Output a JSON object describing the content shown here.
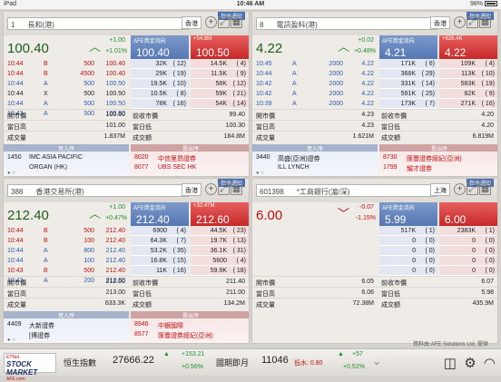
{
  "status": {
    "device": "iPad",
    "time": "10:46 AM",
    "battery": "98%"
  },
  "panels": [
    {
      "code": "1",
      "name": "長和(港)",
      "market": "香港",
      "tag": "指令通知",
      "last": "100.40",
      "last_color": "green",
      "change": "+1.00",
      "change_pct": "+1.01%",
      "direction": "up",
      "bid_label": "AFE資金流向",
      "ask_label": "+54.8M",
      "bid": "100.40",
      "ask": "100.50",
      "trades": [
        {
          "time": "10:44",
          "side": "B",
          "qty": "500",
          "price": "100.40",
          "color": "red"
        },
        {
          "time": "10:44",
          "side": "B",
          "qty": "4500",
          "price": "100.40",
          "color": "red"
        },
        {
          "time": "10:44",
          "side": "A",
          "qty": "500",
          "price": "100.50",
          "color": "blue"
        },
        {
          "time": "10:44",
          "side": "X",
          "qty": "500",
          "price": "100.50",
          "color": "blk"
        },
        {
          "time": "10:44",
          "side": "A",
          "qty": "500",
          "price": "100.50",
          "color": "blue"
        },
        {
          "time": "10:43",
          "side": "A",
          "qty": "500",
          "price": "100.50",
          "color": "blue"
        }
      ],
      "depth": [
        {
          "bid": "32K",
          "bidn": "( 12)",
          "ask": "14.5K",
          "askn": "(  4)"
        },
        {
          "bid": "29K",
          "bidn": "( 19)",
          "ask": "11.5K",
          "askn": "(  9)"
        },
        {
          "bid": "19.5K",
          "bidn": "( 10)",
          "ask": "58K",
          "askn": "( 12)"
        },
        {
          "bid": "10.5K",
          "bidn": "(  8)",
          "ask": "59K",
          "askn": "( 21)"
        },
        {
          "bid": "78K",
          "bidn": "( 16)",
          "ask": "54K",
          "askn": "( 14)"
        }
      ],
      "stats": [
        {
          "k1": "開市價",
          "v1": "100.60",
          "k2": "前收市價",
          "v2": "99.40"
        },
        {
          "k1": "當日高",
          "v1": "101.00",
          "k2": "當日低",
          "v2": "100.30"
        },
        {
          "k1": "成交量",
          "v1": "1.837M",
          "k2": "成交額",
          "v2": "184.8M"
        }
      ],
      "broker_buy_label": "買入序",
      "broker_sell_label": "賣出序",
      "broker_buy": [
        {
          "id": "1450",
          "name": "IMC ASIA PACIFIC"
        },
        {
          "id": "",
          "name": "ORGAN (HK)"
        }
      ],
      "broker_sell": [
        {
          "id": "8020",
          "name": "中信里昂證券"
        },
        {
          "id": "8077",
          "name": "UBS SEC HK"
        }
      ]
    },
    {
      "code": "8",
      "name": "電訊盈科(港)",
      "market": "香港",
      "tag": "指令通知",
      "last": "4.22",
      "last_color": "green",
      "change": "+0.02",
      "change_pct": "+0.48%",
      "direction": "up",
      "bid_label": "AFE資金流向",
      "ask_label": "+926.4K",
      "bid": "4.21",
      "ask": "4.22",
      "trades": [
        {
          "time": "10:45",
          "side": "A",
          "qty": "2000",
          "price": "4.22",
          "color": "blue"
        },
        {
          "time": "10:44",
          "side": "A",
          "qty": "2000",
          "price": "4.22",
          "color": "blue"
        },
        {
          "time": "10:42",
          "side": "A",
          "qty": "2000",
          "price": "4.22",
          "color": "blue"
        },
        {
          "time": "10:42",
          "side": "A",
          "qty": "2000",
          "price": "4.22",
          "color": "blue"
        },
        {
          "time": "10:39",
          "side": "A",
          "qty": "2000",
          "price": "4.22",
          "color": "blue"
        }
      ],
      "depth": [
        {
          "bid": "171K",
          "bidn": "(  6)",
          "ask": "109K",
          "askn": "(  4)"
        },
        {
          "bid": "368K",
          "bidn": "( 29)",
          "ask": "113K",
          "askn": "( 10)"
        },
        {
          "bid": "331K",
          "bidn": "( 14)",
          "ask": "583K",
          "askn": "( 19)"
        },
        {
          "bid": "591K",
          "bidn": "( 25)",
          "ask": "82K",
          "askn": "(  9)"
        },
        {
          "bid": "173K",
          "bidn": "(  7)",
          "ask": "271K",
          "askn": "( 16)"
        }
      ],
      "stats": [
        {
          "k1": "開市價",
          "v1": "4.23",
          "k2": "前收市價",
          "v2": "4.20"
        },
        {
          "k1": "當日高",
          "v1": "4.23",
          "k2": "當日低",
          "v2": "4.20"
        },
        {
          "k1": "成交量",
          "v1": "1.621M",
          "k2": "成交額",
          "v2": "6.819M"
        }
      ],
      "broker_buy_label": "買入序",
      "broker_sell_label": "賣出序",
      "broker_buy": [
        {
          "id": "3440",
          "name": "高盛(亞洲)證券"
        },
        {
          "id": "",
          "name": "ILL LYNCH"
        }
      ],
      "broker_sell": [
        {
          "id": "8730",
          "name": "匯豐證券經紀(亞洲)"
        },
        {
          "id": "1799",
          "name": "耀才證券"
        }
      ]
    },
    {
      "code": "388",
      "name": "香港交易所(港)",
      "market": "香港",
      "tag": "指令通知",
      "last": "212.40",
      "last_color": "green",
      "change": "+1.00",
      "change_pct": "+0.47%",
      "direction": "up",
      "bid_label": "AFE資金流向",
      "ask_label": "+32.47M",
      "bid": "212.40",
      "ask": "212.60",
      "trades": [
        {
          "time": "10:44",
          "side": "B",
          "qty": "500",
          "price": "212.40",
          "color": "red"
        },
        {
          "time": "10:44",
          "side": "B",
          "qty": "100",
          "price": "212.40",
          "color": "red"
        },
        {
          "time": "10:44",
          "side": "A",
          "qty": "800",
          "price": "212.40",
          "color": "blue"
        },
        {
          "time": "10:44",
          "side": "A",
          "qty": "100",
          "price": "212.40",
          "color": "blue"
        },
        {
          "time": "10:43",
          "side": "B",
          "qty": "500",
          "price": "212.40",
          "color": "red"
        },
        {
          "time": "10:43",
          "side": "A",
          "qty": "200",
          "price": "212.60",
          "color": "blue"
        }
      ],
      "depth": [
        {
          "bid": "6900",
          "bidn": "(  4)",
          "ask": "44.5K",
          "askn": "( 23)"
        },
        {
          "bid": "64.3K",
          "bidn": "(  7)",
          "ask": "19.7K",
          "askn": "( 13)"
        },
        {
          "bid": "53.2K",
          "bidn": "( 35)",
          "ask": "36.1K",
          "askn": "( 31)"
        },
        {
          "bid": "16.8K",
          "bidn": "( 15)",
          "ask": "5600",
          "askn": "(  4)"
        },
        {
          "bid": "11K",
          "bidn": "( 16)",
          "ask": "59.9K",
          "askn": "( 18)"
        }
      ],
      "stats": [
        {
          "k1": "開市價",
          "v1": "212.00",
          "k2": "前收市價",
          "v2": "211.40"
        },
        {
          "k1": "當日高",
          "v1": "213.00",
          "k2": "當日低",
          "v2": "211.00"
        },
        {
          "k1": "成交量",
          "v1": "633.3K",
          "k2": "成交額",
          "v2": "134.2M"
        }
      ],
      "broker_buy_label": "買入序",
      "broker_sell_label": "賣出序",
      "broker_buy": [
        {
          "id": "4409",
          "name": "大新證券"
        },
        {
          "id": "",
          "name": "[博證券"
        }
      ],
      "broker_sell": [
        {
          "id": "8946",
          "name": "中銀國際"
        },
        {
          "id": "8577",
          "name": "匯豐證券經紀(亞洲)"
        }
      ]
    },
    {
      "code": "601398",
      "name": "*工商銀行(滬/深)",
      "market": "上海",
      "tag": "指令通知",
      "last": "6.00",
      "last_color": "red",
      "change": "-0.07",
      "change_pct": "-1.15%",
      "direction": "down",
      "bid_label": "AFE資金流向",
      "ask_label": "",
      "bid": "5.99",
      "ask": "6.00",
      "trades": [],
      "depth": [
        {
          "bid": "517K",
          "bidn": "(  1)",
          "ask": "2383K",
          "askn": "(  1)"
        },
        {
          "bid": "0",
          "bidn": "(  0)",
          "ask": "0",
          "askn": "(  0)"
        },
        {
          "bid": "0",
          "bidn": "(  0)",
          "ask": "0",
          "askn": "(  0)"
        },
        {
          "bid": "0",
          "bidn": "(  0)",
          "ask": "0",
          "askn": "(  0)"
        },
        {
          "bid": "0",
          "bidn": "(  0)",
          "ask": "0",
          "askn": "(  0)"
        }
      ],
      "stats": [
        {
          "k1": "開市價",
          "v1": "6.05",
          "k2": "前收市價",
          "v2": "6.07"
        },
        {
          "k1": "當日高",
          "v1": "6.06",
          "k2": "當日低",
          "v2": "5.98"
        },
        {
          "k1": "成交量",
          "v1": "72.38M",
          "k2": "成交額",
          "v2": "435.9M"
        }
      ],
      "broker_buy_label": "",
      "broker_sell_label": "",
      "broker_buy": [],
      "broker_sell": []
    }
  ],
  "footnote": "資料由 AFE Solutions Ltd. 提供",
  "bottom": {
    "logo_top": "ETNet",
    "logo_main": "STOCK MARKET",
    "logo_sub": "AFE.com",
    "index_name": "恒生指數",
    "index_value": "27666.22",
    "index_chg": "+153.21",
    "index_pct": "+0.56%",
    "future_name": "國期即月",
    "future_value": "11046",
    "future_sub": "低水: 0.80",
    "future_chg": "+57",
    "future_pct": "+0.52%"
  }
}
